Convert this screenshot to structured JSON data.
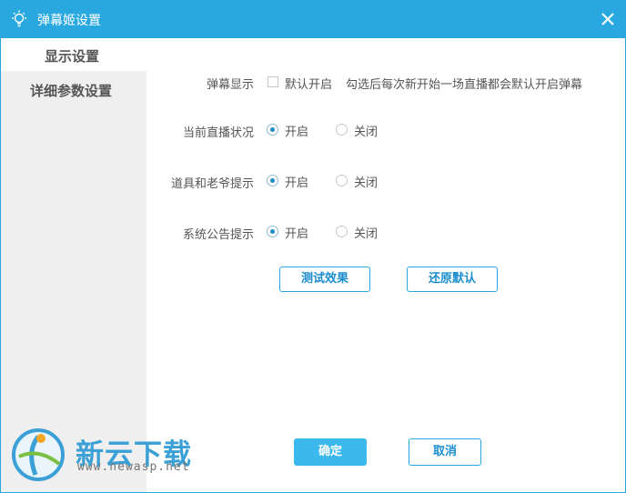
{
  "window": {
    "title": "弹幕姬设置"
  },
  "sidebar": {
    "items": [
      {
        "label": "显示设置",
        "active": true
      },
      {
        "label": "详细参数设置",
        "active": false
      }
    ]
  },
  "settings": {
    "danmaku_display": {
      "label": "弹幕显示",
      "checkbox_label": "默认开启",
      "checked": false,
      "hint": "勾选后每次新开始一场直播都会默认开启弹幕"
    },
    "live_status": {
      "label": "当前直播状况",
      "on": "开启",
      "off": "关闭",
      "selected": "开启"
    },
    "props_hint": {
      "label": "道具和老爷提示",
      "on": "开启",
      "off": "关闭",
      "selected": "开启"
    },
    "system_notice": {
      "label": "系统公告提示",
      "on": "开启",
      "off": "关闭",
      "selected": "开启"
    }
  },
  "actions": {
    "test_effect": "测试效果",
    "restore_default": "还原默认",
    "confirm": "确定",
    "cancel": "取消"
  },
  "watermark": {
    "brand": "新云下载",
    "url": "www.newasp.net"
  },
  "colors": {
    "accent": "#29a8e0",
    "primary_button": "#3cb9ec",
    "sidebar_bg": "#efefef"
  }
}
